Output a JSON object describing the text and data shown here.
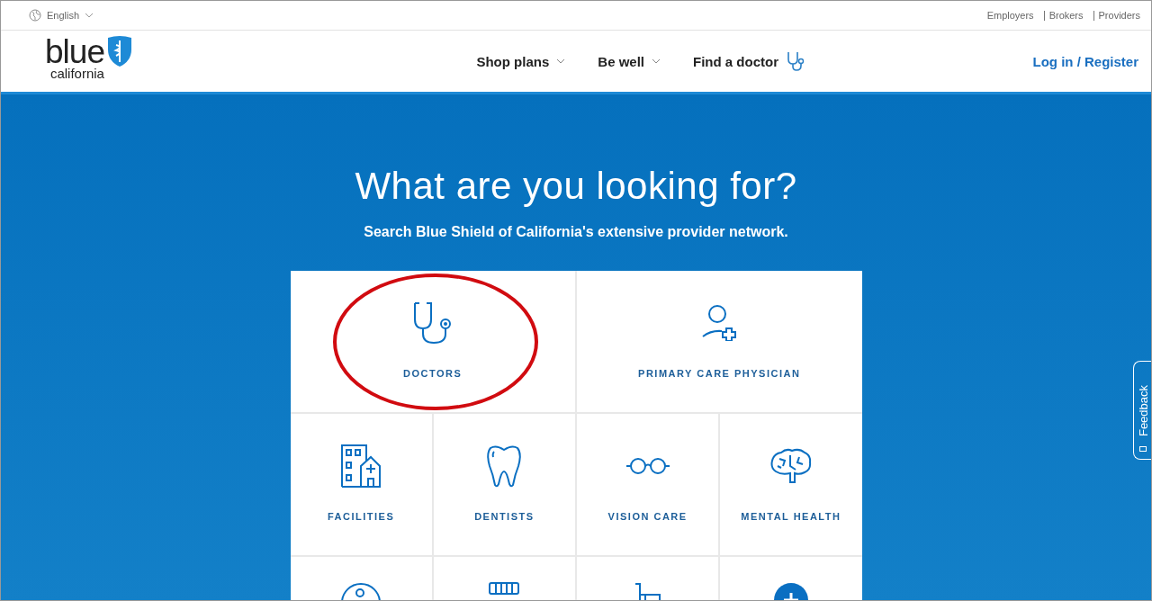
{
  "top_bar": {
    "language": "English",
    "links": [
      "Employers",
      "Brokers",
      "Providers"
    ]
  },
  "header": {
    "logo": {
      "word": "blue",
      "sub": "california"
    },
    "nav": [
      {
        "label": "Shop plans",
        "kind": "dropdown"
      },
      {
        "label": "Be well",
        "kind": "dropdown"
      },
      {
        "label": "Find a doctor",
        "kind": "stethoscope"
      }
    ],
    "login": "Log in / Register"
  },
  "hero": {
    "title": "What are you looking for?",
    "subtitle": "Search Blue Shield of California's extensive provider network."
  },
  "featured_tiles": [
    {
      "label": "DOCTORS",
      "kind": "stethoscope",
      "highlighted": true
    },
    {
      "label": "PRIMARY CARE PHYSICIAN",
      "kind": "person",
      "highlighted": false
    }
  ],
  "tiles": [
    {
      "label": "FACILITIES",
      "kind": "building",
      "highlighted": false
    },
    {
      "label": "DENTISTS",
      "kind": "tooth",
      "highlighted": false
    },
    {
      "label": "VISION CARE",
      "kind": "glasses",
      "highlighted": false
    },
    {
      "label": "MENTAL HEALTH",
      "kind": "brain",
      "highlighted": false
    },
    {
      "kind": "circle",
      "highlighted": false
    },
    {
      "kind": "strip",
      "highlighted": false
    },
    {
      "kind": "cart",
      "highlighted": false
    },
    {
      "kind": "plus",
      "highlighted": false
    }
  ],
  "feedback": "Feedback"
}
